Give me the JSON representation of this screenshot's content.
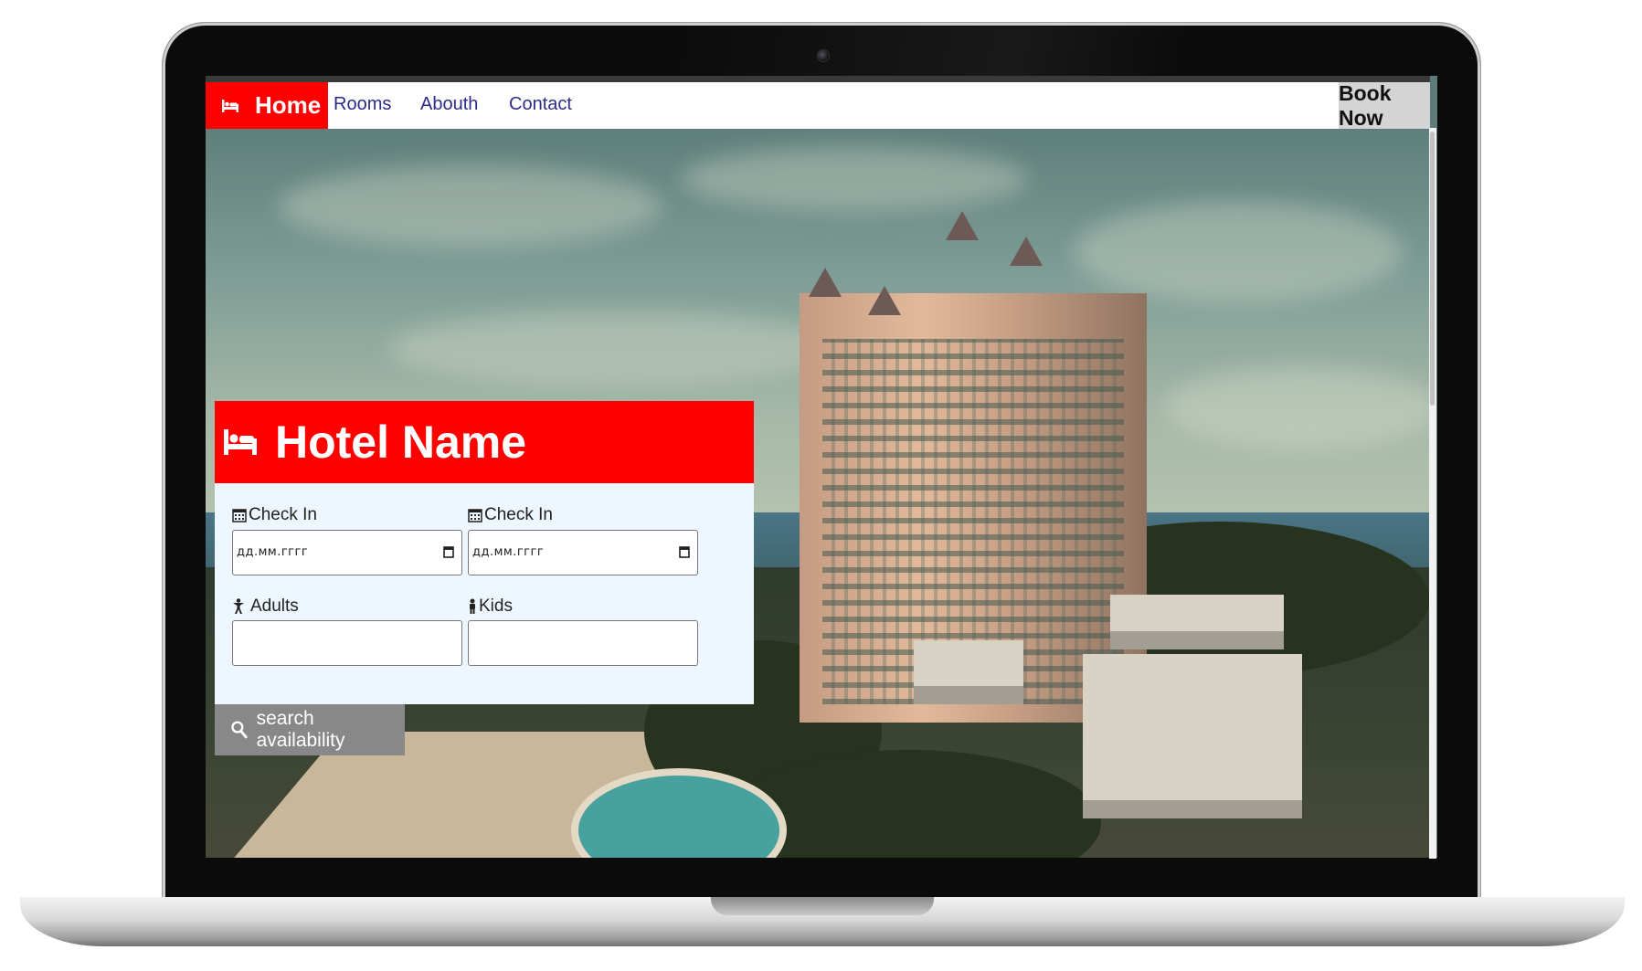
{
  "navbar": {
    "home_label": "Home",
    "links": [
      "Rooms",
      "Abouth",
      "Contact"
    ],
    "book_now_label": "Book Now"
  },
  "booking": {
    "title": "Hotel Name",
    "check_in_label": "Check In",
    "check_out_label": "Check In",
    "date_placeholder": "дд.мм.гггг",
    "adults_label": "Adults",
    "kids_label": "Kids",
    "search_label": "search availability"
  },
  "colors": {
    "accent": "#ff0000",
    "panel_bg": "#eef6ff",
    "nav_link": "#2b2b8a",
    "button_gray": "#888888"
  },
  "icons": [
    "bed-icon",
    "calendar-icon",
    "person-icon",
    "child-icon",
    "search-icon",
    "camera-icon"
  ]
}
